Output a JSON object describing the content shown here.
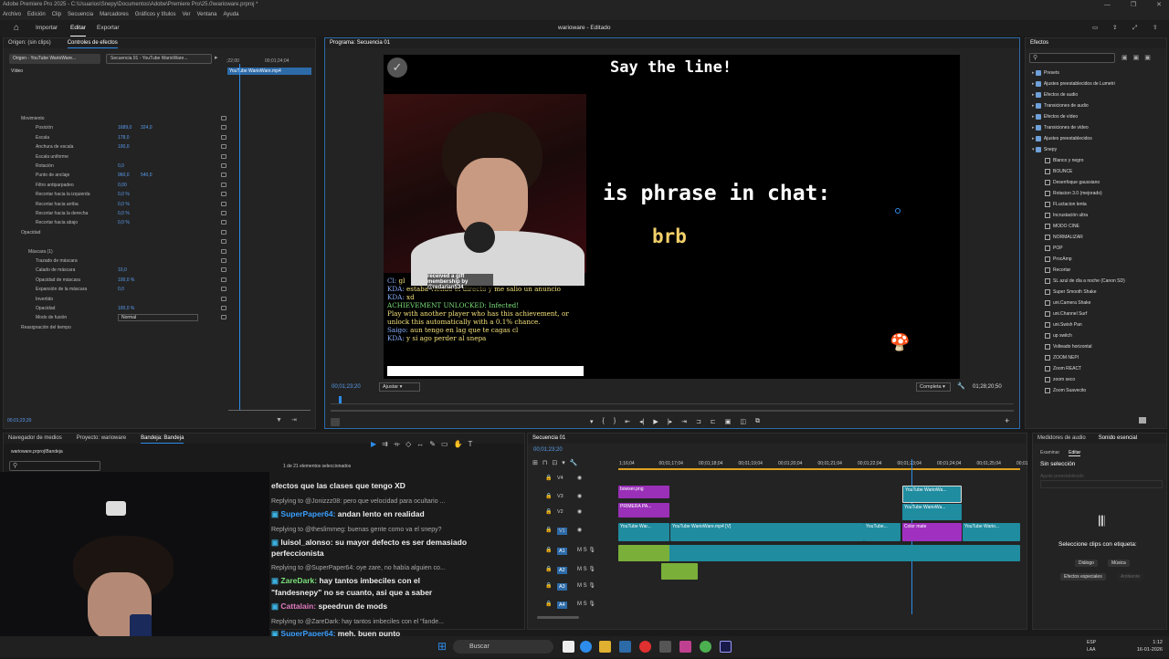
{
  "window": {
    "title": "Adobe Premiere Pro 2025 - C:\\Usuarios\\Snepy\\Documentos\\Adobe\\Premiere Pro\\25.0\\warioware.prproj *",
    "project_title": "warioware - Editado",
    "controls": [
      "—",
      "❐",
      "✕"
    ]
  },
  "menu": [
    "Archivo",
    "Edición",
    "Clip",
    "Secuencia",
    "Marcadores",
    "Gráficos y títulos",
    "Ver",
    "Ventana",
    "Ayuda"
  ],
  "app_tabs": {
    "home": "⌂",
    "importar": "Importar",
    "editar": "Editar",
    "exportar": "Exportar"
  },
  "source_panel": {
    "origin_label": "Origen: (sin clips)",
    "effect_controls_label": "Controles de efectos",
    "master_tab": "Origen - YouTube WarioWare...",
    "seq_tab": "Secuencia 01 - YouTube WarioWare...",
    "ruler_start": ";22;00",
    "ruler_mid": "00;01;24;04",
    "clip_name": "YouTube WarioWare.mp4",
    "section_video": "Vídeo",
    "rows": [
      {
        "label": "Movimiento",
        "value": ""
      },
      {
        "label": "Posición",
        "value": "1689,0",
        "value2": "324,0"
      },
      {
        "label": "Escala",
        "value": "178,0",
        "value2": ""
      },
      {
        "label": "Anchura de escala",
        "value": "100,0",
        "value2": ""
      },
      {
        "label": "Escala uniforme",
        "value": "",
        "value2": ""
      },
      {
        "label": "Rotación",
        "value": "0,0",
        "value2": ""
      },
      {
        "label": "Punto de anclaje",
        "value": "960,0",
        "value2": "540,0"
      },
      {
        "label": "Filtro antiparpadeo",
        "value": "0,00",
        "value2": ""
      },
      {
        "label": "Recortar hacia la izquierda",
        "value": "0,0 %",
        "value2": ""
      },
      {
        "label": "Recortar hacia arriba",
        "value": "0,0 %",
        "value2": ""
      },
      {
        "label": "Recortar hacia la derecha",
        "value": "0,0 %",
        "value2": ""
      },
      {
        "label": "Recortar hacia abajo",
        "value": "0,0 %",
        "value2": ""
      },
      {
        "label": "Opacidad",
        "value": "",
        "value2": ""
      },
      {
        "label": "",
        "value": "",
        "value2": ""
      },
      {
        "label": "Máscara (1)",
        "value": "",
        "value2": ""
      },
      {
        "label": "Trazado de máscara",
        "value": "",
        "value2": ""
      },
      {
        "label": "Calado de máscara",
        "value": "10,0",
        "value2": ""
      },
      {
        "label": "Opacidad de máscara",
        "value": "100,0 %",
        "value2": ""
      },
      {
        "label": "Expansión de la máscara",
        "value": "0,0",
        "value2": ""
      },
      {
        "label": "Invertido",
        "value": "",
        "value2": ""
      },
      {
        "label": "Opacidad",
        "value": "100,0 %",
        "value2": ""
      },
      {
        "label": "Modo de fusión",
        "value": "Normal",
        "value2": ""
      },
      {
        "label": "Reasignación del tiempo",
        "value": "",
        "value2": ""
      }
    ],
    "timecode": "00;01;23;20"
  },
  "program": {
    "header": "Programa: Secuencia 01",
    "game_title": "Say the line!",
    "phrase": "is phrase in chat:",
    "word": "brb",
    "stream_lines": [
      {
        "who": "Cl: ",
        "text": "gl"
      },
      {
        "who": "KDA: ",
        "text": "estaba viendo el directo y me salio un anuncio"
      },
      {
        "who": "KDA: ",
        "text": "xd"
      },
      {
        "who": "",
        "text": "ACHIEVEMENT UNLOCKED: Infected!"
      },
      {
        "who": "",
        "text": "Play with another player who has this achievement, or"
      },
      {
        "who": "",
        "text": "unlock this automatically with a 0.1% chance."
      },
      {
        "who": "Saigo: ",
        "text": "aun tengo en lag que te cagas cl"
      },
      {
        "who": "KDA: ",
        "text": "y si ago perder al snepa"
      }
    ],
    "gift_text": "received a gift membership by",
    "gift_user": "@redarian534",
    "timecode": "00;01;23;20",
    "fit": "Ajustar",
    "quality": "Completa",
    "duration": "01;28;20;50"
  },
  "effects": {
    "header": "Efectos",
    "items": [
      {
        "label": "Presets",
        "kind": "folder",
        "level": 0
      },
      {
        "label": "Ajustes preestablecidos de Lumetri",
        "kind": "folder",
        "level": 0
      },
      {
        "label": "Efectos de audio",
        "kind": "folder",
        "level": 0
      },
      {
        "label": "Transiciones de audio",
        "kind": "folder",
        "level": 0
      },
      {
        "label": "Efectos de vídeo",
        "kind": "folder",
        "level": 0
      },
      {
        "label": "Transiciones de vídeo",
        "kind": "folder",
        "level": 0
      },
      {
        "label": "Ajustes preestablecidos",
        "kind": "folder",
        "level": 0
      },
      {
        "label": "Snepy",
        "kind": "folder",
        "level": 0
      },
      {
        "label": "Blanco y negro",
        "kind": "fx",
        "level": 1
      },
      {
        "label": "BOUNCE",
        "kind": "fx",
        "level": 1
      },
      {
        "label": "Desenfoque gaussiano",
        "kind": "fx",
        "level": 1
      },
      {
        "label": "Rotacion 3.0 (mejorado)",
        "kind": "fx",
        "level": 1
      },
      {
        "label": "FLuctacion lenta",
        "kind": "fx",
        "level": 1
      },
      {
        "label": "Incrustación ultra",
        "kind": "fx",
        "level": 1
      },
      {
        "label": "MODO CINE",
        "kind": "fx",
        "level": 1
      },
      {
        "label": "NORMALIZAR",
        "kind": "fx",
        "level": 1
      },
      {
        "label": "POP",
        "kind": "fx",
        "level": 1
      },
      {
        "label": "ProcAmp",
        "kind": "fx",
        "level": 1
      },
      {
        "label": "Recortar",
        "kind": "fx",
        "level": 1
      },
      {
        "label": "SL azul de día a noche (Canon SD)",
        "kind": "fx",
        "level": 1
      },
      {
        "label": "Super Smooth Shake",
        "kind": "fx",
        "level": 1
      },
      {
        "label": "uni.Camera Shake",
        "kind": "fx",
        "level": 1
      },
      {
        "label": "uni.Channel Surf",
        "kind": "fx",
        "level": 1
      },
      {
        "label": "uni.Swish Pan",
        "kind": "fx",
        "level": 1
      },
      {
        "label": "up switch",
        "kind": "fx",
        "level": 1
      },
      {
        "label": "Volteado horizontal",
        "kind": "fx",
        "level": 1
      },
      {
        "label": "ZOOM NEPI",
        "kind": "fx",
        "level": 1
      },
      {
        "label": "Zoom REACT",
        "kind": "fx",
        "level": 1
      },
      {
        "label": "zoom seco",
        "kind": "fx",
        "level": 1
      },
      {
        "label": "Zoom Suavecito",
        "kind": "fx",
        "level": 1
      }
    ]
  },
  "bottom_tabs": {
    "media": "Navegador de medios",
    "project": "Proyecto: warioware",
    "bin": "Bandeja: Bandeja",
    "file": "warioware.prproj\\Bandeja",
    "selected": "1 de 21 elementos seleccionados"
  },
  "chat": [
    {
      "user": "",
      "text": "efectos que las clases que tengo XD",
      "reply": ""
    },
    {
      "user": "",
      "text": "",
      "reply": "Replying to @Jonizzz08: pero que velocidad para ocultario ..."
    },
    {
      "user": "SuperPaper64:",
      "text": " andan lento en realidad",
      "reply": ""
    },
    {
      "user": "",
      "text": "",
      "reply": "Replying to @theslimmeg: buenas gente como va el snepy?"
    },
    {
      "user": "luisol_alonso:",
      "text": " su mayor defecto es ser demasiado",
      "reply": ""
    },
    {
      "user": "",
      "text": "perfeccionista",
      "reply": ""
    },
    {
      "user": "",
      "text": "",
      "reply": "Replying to @SuperPaper64: oye zare, no había alguien co..."
    },
    {
      "user": "ZareDark:",
      "text": " hay tantos imbeciles con el",
      "reply": ""
    },
    {
      "user": "",
      "text": "\"fandesnepy\" no se cuanto, asi que a saber",
      "reply": ""
    },
    {
      "user": "Cattalain:",
      "text": " speedrun de mods",
      "reply": ""
    },
    {
      "user": "",
      "text": "",
      "reply": "Replying to @ZareDark: hay tantos imbeciles con el \"fande..."
    },
    {
      "user": "SuperPaper64:",
      "text": " meh, buen punto",
      "reply": ""
    }
  ],
  "timeline": {
    "header": "Secuencia 01",
    "timecode": "00;01;23;20",
    "ticks": [
      "1;16;04",
      "00;01;17;04",
      "00;01;18;04",
      "00;01;19;04",
      "00;01;20;04",
      "00;01;21;04",
      "00;01;22;04",
      "00;01;23;04",
      "00;01;24;04",
      "00;01;25;04",
      "00;01"
    ],
    "tracks": [
      "V4",
      "V3",
      "V2",
      "V1",
      "A1",
      "A2",
      "A3",
      "A4"
    ],
    "clips": {
      "bowser": "bowser.png",
      "primera": "PRIMERA PA...",
      "yt1": "YouTube War...",
      "yt2": "YouTube WarioWare.mp4 [V]",
      "yt3": "YouTube WarioWa...",
      "yt4": "YouTube WarioWa...",
      "yt5": "YouTube...",
      "color": "Color mate",
      "yt6": "YouTube Wario..."
    }
  },
  "essential_sound": {
    "meters": "Medidores de audio",
    "header": "Sonido esencial",
    "tab1": "Examinar",
    "tab2": "Editar",
    "no_selection": "Sin selección",
    "preset_hint": "Ajuste preestablecido",
    "prompt": "Seleccione clips con etiqueta:",
    "btn_dialog": "Diálogo",
    "btn_music": "Música",
    "btn_sfx": "Efectos especiales",
    "btn_amb": "Ambiente"
  },
  "taskbar": {
    "search": "Buscar",
    "lang": "ESP",
    "lang2": "LAA",
    "time": "1:12",
    "date": "16-01-2026"
  },
  "colors": {
    "accent": "#2d8ceb",
    "clip_purple": "#a030c0",
    "clip_teal": "#1e8ca0",
    "clip_green": "#7ab03a"
  }
}
